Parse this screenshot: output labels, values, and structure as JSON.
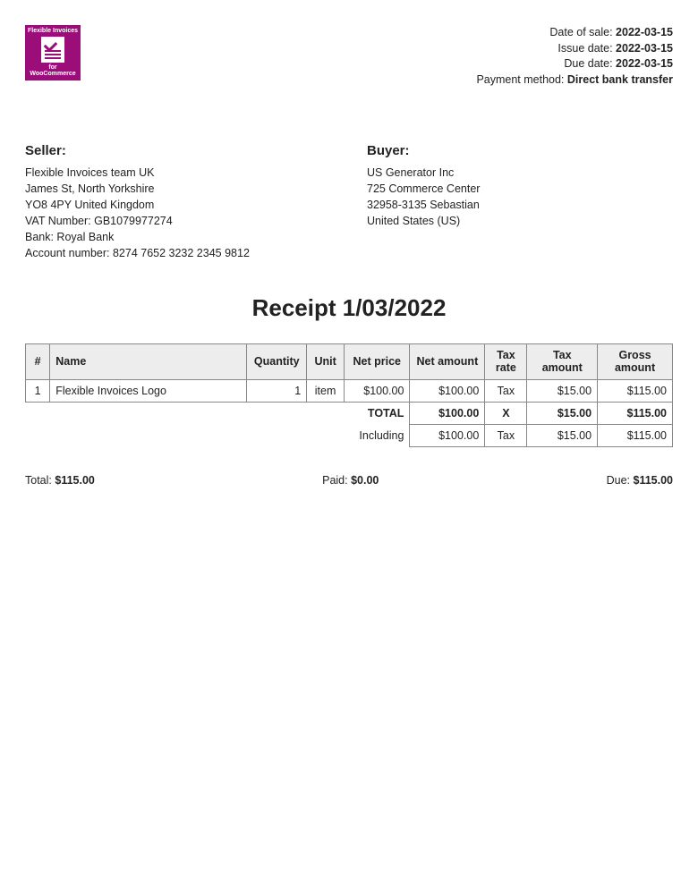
{
  "logo": {
    "top": "Flexible Invoices",
    "bottom": "for WooCommerce"
  },
  "meta": {
    "date_of_sale_label": "Date of sale:",
    "date_of_sale": "2022-03-15",
    "issue_date_label": "Issue date:",
    "issue_date": "2022-03-15",
    "due_date_label": "Due date:",
    "due_date": "2022-03-15",
    "payment_method_label": "Payment method:",
    "payment_method": "Direct bank transfer"
  },
  "seller": {
    "heading": "Seller:",
    "lines": [
      "Flexible Invoices team UK",
      "James St, North Yorkshire",
      "YO8 4PY United Kingdom",
      "VAT Number: GB1079977274",
      "Bank: Royal Bank",
      "Account number: 8274 7652 3232 2345 9812"
    ]
  },
  "buyer": {
    "heading": "Buyer:",
    "lines": [
      "US Generator Inc",
      "725 Commerce Center",
      "32958-3135 Sebastian",
      "United States (US)"
    ]
  },
  "title": "Receipt 1/03/2022",
  "columns": {
    "num": "#",
    "name": "Name",
    "qty": "Quantity",
    "unit": "Unit",
    "net_price": "Net price",
    "net_amount": "Net amount",
    "tax_rate": "Tax rate",
    "tax_amount": "Tax amount",
    "gross_amount": "Gross amount"
  },
  "row": {
    "num": "1",
    "name": "Flexible Invoices Logo",
    "qty": "1",
    "unit": "item",
    "net_price": "$100.00",
    "net_amount": "$100.00",
    "tax_rate": "Tax",
    "tax_amount": "$15.00",
    "gross_amount": "$115.00"
  },
  "total_row": {
    "label": "TOTAL",
    "net_amount": "$100.00",
    "tax_rate": "X",
    "tax_amount": "$15.00",
    "gross_amount": "$115.00"
  },
  "including_row": {
    "label": "Including",
    "net_amount": "$100.00",
    "tax_rate": "Tax",
    "tax_amount": "$15.00",
    "gross_amount": "$115.00"
  },
  "summary": {
    "total_label": "Total:",
    "total": "$115.00",
    "paid_label": "Paid:",
    "paid": "$0.00",
    "due_label": "Due:",
    "due": "$115.00"
  }
}
